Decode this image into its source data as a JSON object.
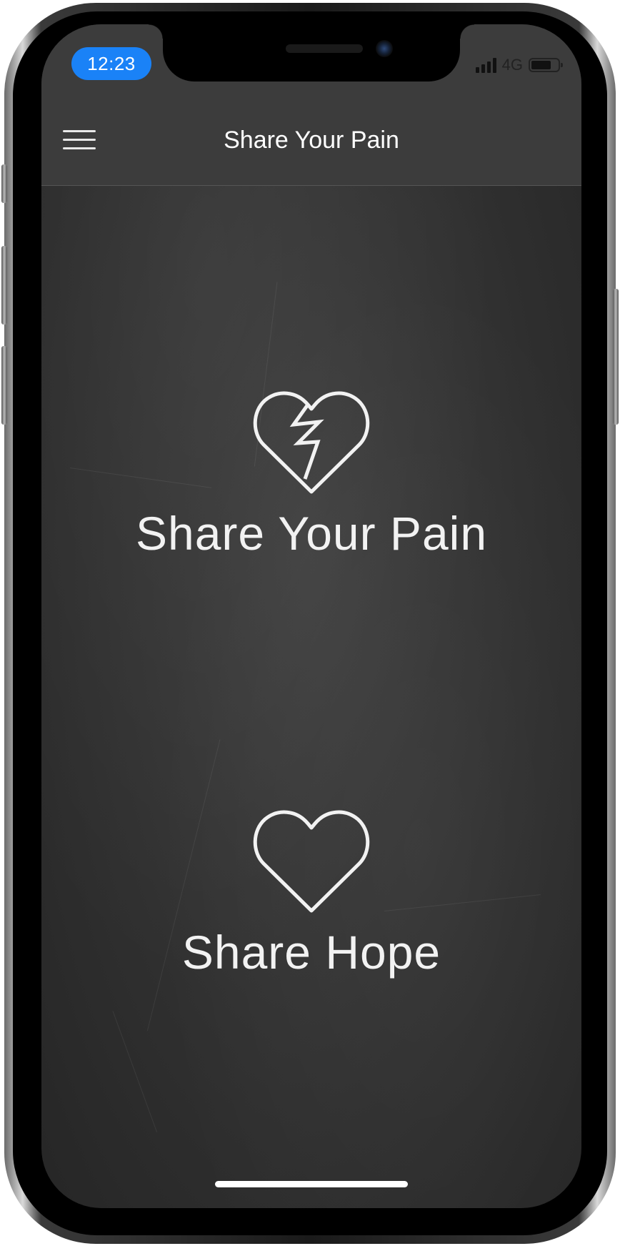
{
  "status_bar": {
    "time": "12:23",
    "network": "4G",
    "time_pill_color": "#1a82f7",
    "battery_level": 0.75
  },
  "header": {
    "title": "Share Your Pain",
    "menu_icon": "hamburger-menu-icon"
  },
  "actions": [
    {
      "label": "Share Your Pain",
      "icon": "broken-heart-icon"
    },
    {
      "label": "Share Hope",
      "icon": "heart-icon"
    }
  ],
  "theme": {
    "background": "chalkboard",
    "header_bg": "#3c3c3c",
    "text_color": "#f2f2f2"
  }
}
